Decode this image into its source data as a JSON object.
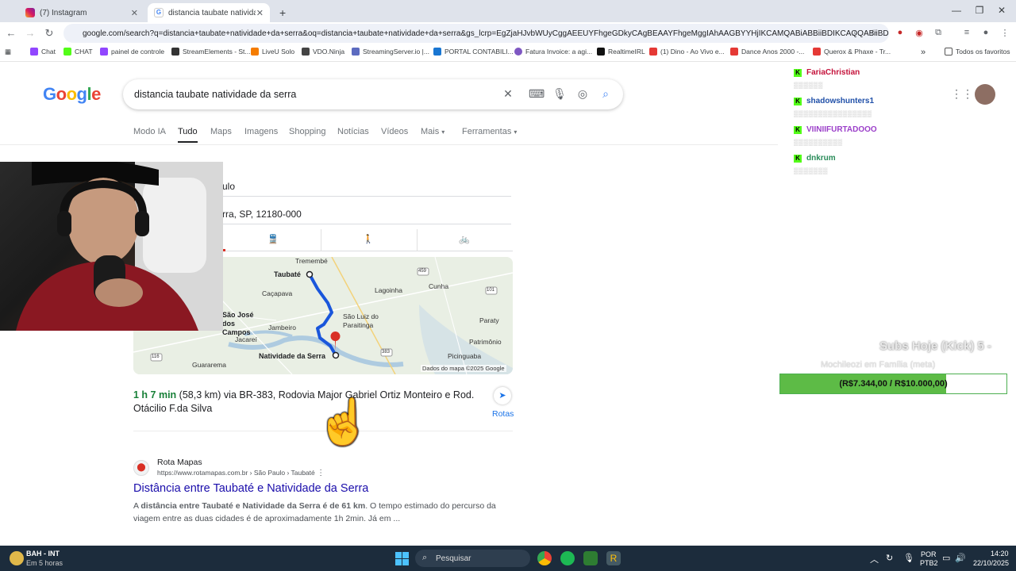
{
  "browser": {
    "tabs": [
      {
        "title": "(7) Instagram"
      },
      {
        "title": "distancia taubate natividade da"
      }
    ],
    "new_tab": "+",
    "url": "google.com/search?q=distancia+taubate+natividade+da+serra&oq=distancia+taubate+natividade+da+serra&gs_lcrp=EgZjaHJvbWUyCggAEEUYFhgeGDkyCAgBEAAYFhgeMggIAhAAGBYYHjIKCAMQABiABBiiBDIKCAQQABiiBDI...",
    "bookmarks": [
      "Chat",
      "CHAT",
      "painel de controle",
      "StreamElements - St...",
      "LiveU Solo",
      "VDO.Ninja",
      "StreamingServer.io |...",
      "PORTAL CONTABILI...",
      "Fatura Invoice: a agi...",
      "RealtimeIRL",
      "(1) Dino - Ao Vivo e...",
      "Dance Anos 2000 -...",
      "Querox & Phaxe - Tr..."
    ],
    "all_bookmarks": "Todos os favoritos"
  },
  "google": {
    "logo": "Google",
    "query": "distancia taubate natividade da serra",
    "tabs": [
      "Modo IA",
      "Tudo",
      "Maps",
      "Imagens",
      "Shopping",
      "Notícias",
      "Vídeos",
      "Mais",
      "Ferramentas"
    ],
    "origin": "ulo",
    "destination": "rra, SP, 12180-000",
    "map": {
      "labels": [
        "Tremembé",
        "Taubaté",
        "Caçapava",
        "Lagoinha",
        "Cunha",
        "São José dos Campos",
        "Jambeiro",
        "São Luiz do Paraitinga",
        "Paraty",
        "Jacareí",
        "Natividade da Serra",
        "Patrimônio",
        "Guararema",
        "Picinguaba"
      ],
      "roads": [
        "459",
        "101",
        "116",
        "383"
      ],
      "attribution": "Dados do mapa ©2025 Google"
    },
    "route": {
      "duration": "1 h 7 min",
      "details": "(58,3 km) via BR-383, Rodovia Major Gabriel Ortiz Monteiro e Rod. Otácilio F.da Silva",
      "rotas": "Rotas"
    },
    "result": {
      "site": "Rota Mapas",
      "url": "https://www.rotamapas.com.br › São Paulo › Taubaté",
      "title": "Distância entre Taubaté e Natividade da Serra",
      "snippet_a": "A ",
      "snippet_b": "distância entre Taubaté e Natividade da Serra é de 61 km",
      "snippet_c": ". O tempo estimado do percurso da viagem entre as duas cidades é de aproximadamente 1h 2min. Já em ..."
    }
  },
  "overlay": {
    "chat": [
      {
        "name": "FariaChristian",
        "color": "#c4113a"
      },
      {
        "name": "shadowshunters1",
        "color": "#1f4fa8"
      },
      {
        "name": "VIINIIFURTADOOO",
        "color": "#9b3fc9"
      },
      {
        "name": "dnkrum",
        "color": "#2a8c5a"
      }
    ],
    "subs_title": "Subs Hoje (Kick)  5 -",
    "subs_sub": "Mochileozi em Família (meta)",
    "goal_text": "(R$7.344,00 / R$10.000,00)",
    "goal_fraction": 0.7344
  },
  "taskbar": {
    "weather_title": "BAH - INT",
    "weather_sub": "Em 5 horas",
    "search": "Pesquisar",
    "lang1": "POR",
    "lang2": "PTB2",
    "time": "14:20",
    "date": "22/10/2025"
  }
}
